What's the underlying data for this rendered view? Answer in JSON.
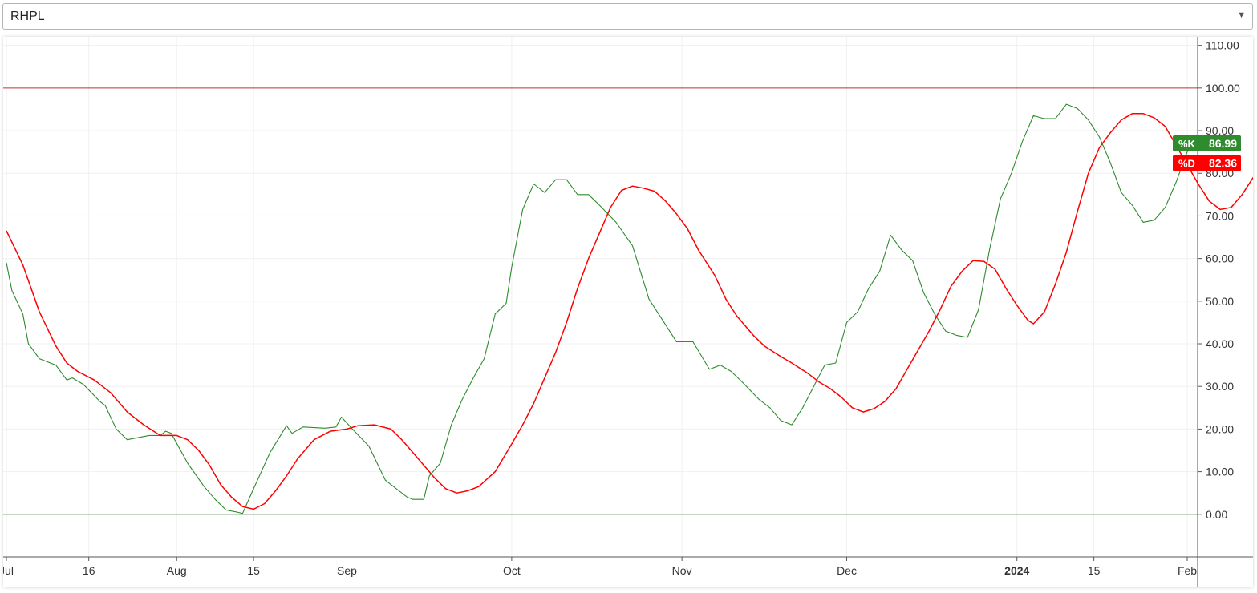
{
  "selector": {
    "value": "RHPL"
  },
  "icons": {
    "caret": "▼"
  },
  "chart_data": {
    "type": "line",
    "ylim": [
      -10,
      112
    ],
    "yticks": [
      0,
      10,
      20,
      30,
      40,
      50,
      60,
      70,
      80,
      90,
      100,
      110
    ],
    "ytick_labels": [
      "0.00",
      "10.00",
      "20.00",
      "30.00",
      "40.00",
      "50.00",
      "60.00",
      "70.00",
      "80.00",
      "90.00",
      "100.00",
      "110.00"
    ],
    "xlim": [
      "2023-07-01",
      "2024-02-01"
    ],
    "xticks": [
      {
        "date": "2023-07-01",
        "label": "Jul",
        "bold": false
      },
      {
        "date": "2023-07-16",
        "label": "16",
        "bold": false
      },
      {
        "date": "2023-08-01",
        "label": "Aug",
        "bold": false
      },
      {
        "date": "2023-08-15",
        "label": "15",
        "bold": false
      },
      {
        "date": "2023-09-01",
        "label": "Sep",
        "bold": false
      },
      {
        "date": "2023-10-01",
        "label": "Oct",
        "bold": false
      },
      {
        "date": "2023-11-01",
        "label": "Nov",
        "bold": false
      },
      {
        "date": "2023-12-01",
        "label": "Dec",
        "bold": false
      },
      {
        "date": "2024-01-01",
        "label": "2024",
        "bold": true
      },
      {
        "date": "2024-01-15",
        "label": "15",
        "bold": false
      },
      {
        "date": "2024-02-01",
        "label": "Feb",
        "bold": false
      }
    ],
    "hlines": [
      {
        "value": 100,
        "color": "#c0392b"
      },
      {
        "value": 0,
        "color": "#1b5e20"
      }
    ],
    "series": [
      {
        "name": "%K",
        "color": "#2e8b2e",
        "last_label": "86.99",
        "points": [
          [
            "2023-07-01",
            59
          ],
          [
            "2023-07-02",
            52.5
          ],
          [
            "2023-07-04",
            47
          ],
          [
            "2023-07-05",
            40
          ],
          [
            "2023-07-07",
            36.5
          ],
          [
            "2023-07-10",
            35
          ],
          [
            "2023-07-12",
            31.5
          ],
          [
            "2023-07-13",
            32
          ],
          [
            "2023-07-15",
            30.5
          ],
          [
            "2023-07-18",
            26.5
          ],
          [
            "2023-07-19",
            25.5
          ],
          [
            "2023-07-21",
            20
          ],
          [
            "2023-07-23",
            17.5
          ],
          [
            "2023-07-27",
            18.5
          ],
          [
            "2023-07-29",
            18.5
          ],
          [
            "2023-07-30",
            19.5
          ],
          [
            "2023-07-31",
            19
          ],
          [
            "2023-08-03",
            12
          ],
          [
            "2023-08-06",
            6.5
          ],
          [
            "2023-08-08",
            3.5
          ],
          [
            "2023-08-10",
            1
          ],
          [
            "2023-08-12",
            0.5
          ],
          [
            "2023-08-13",
            0.2
          ],
          [
            "2023-08-15",
            6
          ],
          [
            "2023-08-18",
            14.5
          ],
          [
            "2023-08-21",
            20.8
          ],
          [
            "2023-08-22",
            19
          ],
          [
            "2023-08-24",
            20.5
          ],
          [
            "2023-08-28",
            20.2
          ],
          [
            "2023-08-30",
            20.5
          ],
          [
            "2023-08-31",
            22.8
          ],
          [
            "2023-09-02",
            20
          ],
          [
            "2023-09-05",
            16
          ],
          [
            "2023-09-08",
            8
          ],
          [
            "2023-09-10",
            6
          ],
          [
            "2023-09-12",
            4
          ],
          [
            "2023-09-13",
            3.5
          ],
          [
            "2023-09-15",
            3.5
          ],
          [
            "2023-09-16",
            9
          ],
          [
            "2023-09-18",
            12
          ],
          [
            "2023-09-20",
            21
          ],
          [
            "2023-09-22",
            27
          ],
          [
            "2023-09-24",
            32
          ],
          [
            "2023-09-26",
            36.5
          ],
          [
            "2023-09-28",
            47
          ],
          [
            "2023-09-30",
            49.5
          ],
          [
            "2023-10-01",
            58
          ],
          [
            "2023-10-03",
            71.5
          ],
          [
            "2023-10-05",
            77.5
          ],
          [
            "2023-10-07",
            75.5
          ],
          [
            "2023-10-09",
            78.5
          ],
          [
            "2023-10-11",
            78.5
          ],
          [
            "2023-10-13",
            75
          ],
          [
            "2023-10-15",
            75
          ],
          [
            "2023-10-17",
            72.5
          ],
          [
            "2023-10-20",
            68.5
          ],
          [
            "2023-10-23",
            63
          ],
          [
            "2023-10-26",
            50.5
          ],
          [
            "2023-10-29",
            44.5
          ],
          [
            "2023-10-31",
            40.5
          ],
          [
            "2023-11-03",
            40.5
          ],
          [
            "2023-11-06",
            34
          ],
          [
            "2023-11-08",
            35
          ],
          [
            "2023-11-10",
            33.5
          ],
          [
            "2023-11-12",
            31
          ],
          [
            "2023-11-15",
            27
          ],
          [
            "2023-11-17",
            25
          ],
          [
            "2023-11-19",
            22
          ],
          [
            "2023-11-21",
            21
          ],
          [
            "2023-11-23",
            25
          ],
          [
            "2023-11-25",
            30
          ],
          [
            "2023-11-27",
            35
          ],
          [
            "2023-11-29",
            35.5
          ],
          [
            "2023-12-01",
            45
          ],
          [
            "2023-12-03",
            47.5
          ],
          [
            "2023-12-05",
            53
          ],
          [
            "2023-12-07",
            57
          ],
          [
            "2023-12-09",
            65.5
          ],
          [
            "2023-12-11",
            62
          ],
          [
            "2023-12-13",
            59.5
          ],
          [
            "2023-12-15",
            52
          ],
          [
            "2023-12-17",
            47
          ],
          [
            "2023-12-19",
            43
          ],
          [
            "2023-12-21",
            42
          ],
          [
            "2023-12-23",
            41.5
          ],
          [
            "2023-12-25",
            48
          ],
          [
            "2023-12-27",
            62
          ],
          [
            "2023-12-29",
            74
          ],
          [
            "2023-12-31",
            80
          ],
          [
            "2024-01-02",
            87.5
          ],
          [
            "2024-01-04",
            93.5
          ],
          [
            "2024-01-06",
            92.8
          ],
          [
            "2024-01-08",
            92.8
          ],
          [
            "2024-01-10",
            96.2
          ],
          [
            "2024-01-12",
            95.2
          ],
          [
            "2024-01-14",
            92.5
          ],
          [
            "2024-01-16",
            88.5
          ],
          [
            "2024-01-18",
            82.5
          ],
          [
            "2024-01-20",
            75.5
          ],
          [
            "2024-01-22",
            72.5
          ],
          [
            "2024-01-24",
            68.5
          ],
          [
            "2024-01-26",
            69
          ],
          [
            "2024-01-28",
            72
          ],
          [
            "2024-01-30",
            78
          ],
          [
            "2024-02-01",
            85
          ],
          [
            "2024-02-03",
            89
          ],
          [
            "2024-02-05",
            86.99
          ]
        ]
      },
      {
        "name": "%D",
        "color": "#ff0000",
        "last_label": "82.36",
        "points": [
          [
            "2023-07-01",
            66.5
          ],
          [
            "2023-07-04",
            58.5
          ],
          [
            "2023-07-07",
            47.5
          ],
          [
            "2023-07-10",
            39.5
          ],
          [
            "2023-07-12",
            35.5
          ],
          [
            "2023-07-14",
            33.5
          ],
          [
            "2023-07-17",
            31.5
          ],
          [
            "2023-07-20",
            28.5
          ],
          [
            "2023-07-23",
            24
          ],
          [
            "2023-07-26",
            21
          ],
          [
            "2023-07-29",
            18.5
          ],
          [
            "2023-08-01",
            18.5
          ],
          [
            "2023-08-03",
            17.5
          ],
          [
            "2023-08-05",
            15
          ],
          [
            "2023-08-07",
            11.5
          ],
          [
            "2023-08-09",
            7
          ],
          [
            "2023-08-11",
            4
          ],
          [
            "2023-08-13",
            1.8
          ],
          [
            "2023-08-15",
            1.2
          ],
          [
            "2023-08-17",
            2.5
          ],
          [
            "2023-08-19",
            5.5
          ],
          [
            "2023-08-21",
            9
          ],
          [
            "2023-08-23",
            13
          ],
          [
            "2023-08-26",
            17.5
          ],
          [
            "2023-08-29",
            19.5
          ],
          [
            "2023-09-01",
            20
          ],
          [
            "2023-09-03",
            20.8
          ],
          [
            "2023-09-06",
            21
          ],
          [
            "2023-09-09",
            20
          ],
          [
            "2023-09-11",
            17.5
          ],
          [
            "2023-09-14",
            13
          ],
          [
            "2023-09-17",
            8.5
          ],
          [
            "2023-09-19",
            6
          ],
          [
            "2023-09-21",
            5
          ],
          [
            "2023-09-23",
            5.5
          ],
          [
            "2023-09-25",
            6.5
          ],
          [
            "2023-09-28",
            10
          ],
          [
            "2023-10-01",
            16.5
          ],
          [
            "2023-10-03",
            21
          ],
          [
            "2023-10-05",
            26
          ],
          [
            "2023-10-07",
            32
          ],
          [
            "2023-10-09",
            38
          ],
          [
            "2023-10-11",
            45
          ],
          [
            "2023-10-13",
            53
          ],
          [
            "2023-10-15",
            60
          ],
          [
            "2023-10-17",
            66
          ],
          [
            "2023-10-19",
            72
          ],
          [
            "2023-10-21",
            76
          ],
          [
            "2023-10-23",
            77
          ],
          [
            "2023-10-25",
            76.5
          ],
          [
            "2023-10-27",
            75.8
          ],
          [
            "2023-10-29",
            73.5
          ],
          [
            "2023-10-31",
            70.5
          ],
          [
            "2023-11-02",
            67
          ],
          [
            "2023-11-04",
            62
          ],
          [
            "2023-11-07",
            56
          ],
          [
            "2023-11-09",
            50.5
          ],
          [
            "2023-11-11",
            46.5
          ],
          [
            "2023-11-14",
            42
          ],
          [
            "2023-11-16",
            39.5
          ],
          [
            "2023-11-19",
            37
          ],
          [
            "2023-11-21",
            35.5
          ],
          [
            "2023-11-24",
            33
          ],
          [
            "2023-11-26",
            31
          ],
          [
            "2023-11-28",
            29.5
          ],
          [
            "2023-11-30",
            27.5
          ],
          [
            "2023-12-02",
            25
          ],
          [
            "2023-12-04",
            24
          ],
          [
            "2023-12-06",
            24.8
          ],
          [
            "2023-12-08",
            26.5
          ],
          [
            "2023-12-10",
            29.5
          ],
          [
            "2023-12-12",
            34
          ],
          [
            "2023-12-14",
            38.5
          ],
          [
            "2023-12-16",
            43
          ],
          [
            "2023-12-18",
            48
          ],
          [
            "2023-12-20",
            53.5
          ],
          [
            "2023-12-22",
            57
          ],
          [
            "2023-12-24",
            59.5
          ],
          [
            "2023-12-26",
            59.3
          ],
          [
            "2023-12-28",
            57.5
          ],
          [
            "2023-12-30",
            53
          ],
          [
            "2024-01-01",
            49
          ],
          [
            "2024-01-03",
            45.5
          ],
          [
            "2024-01-04",
            44.7
          ],
          [
            "2024-01-06",
            47.5
          ],
          [
            "2024-01-08",
            54
          ],
          [
            "2024-01-10",
            61.5
          ],
          [
            "2024-01-12",
            71
          ],
          [
            "2024-01-14",
            80
          ],
          [
            "2024-01-16",
            86
          ],
          [
            "2024-01-18",
            89.5
          ],
          [
            "2024-01-20",
            92.5
          ],
          [
            "2024-01-22",
            94
          ],
          [
            "2024-01-24",
            94
          ],
          [
            "2024-01-26",
            93
          ],
          [
            "2024-01-28",
            91
          ],
          [
            "2024-01-30",
            86.5
          ],
          [
            "2024-02-01",
            82
          ],
          [
            "2024-02-03",
            77.5
          ],
          [
            "2024-02-05",
            73.5
          ],
          [
            "2024-02-07",
            71.5
          ],
          [
            "2024-02-09",
            72
          ],
          [
            "2024-02-11",
            75
          ],
          [
            "2024-02-13",
            79
          ],
          [
            "2024-02-15",
            82.36
          ]
        ]
      }
    ]
  }
}
